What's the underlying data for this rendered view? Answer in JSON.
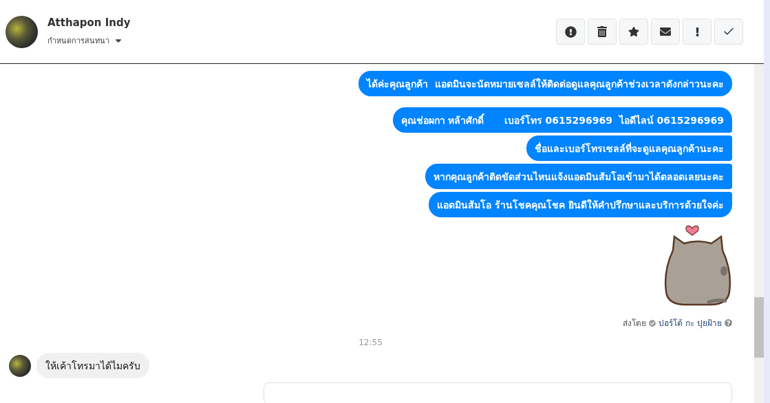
{
  "header": {
    "name": "Atthapon Indy",
    "subtitle": "กำหนดการสนทนา"
  },
  "thread": [
    {
      "kind": "group",
      "messages": [
        "ได้ค่ะคุณลูกค้า  แอดมินจะนัดหมายเซลล์ให้ติดต่อดูแลคุณลูกค้าช่วงเวลาดังกล่าวนะคะ"
      ]
    },
    {
      "kind": "group",
      "messages": [
        "คุณช่อผกา หล้าศักดิ์      เบอร์โทร 0615296969  ไอดีไลน์ 0615296969",
        "ชื่อและเบอร์โทรเซลล์ที่จะดูแลคุณลูกค้านะคะ",
        "หากคุณลูกค้าติดขัดส่วนไหนแจ้งแอดมินส้มโอเข้ามาได้ตลอดเลยนะคะ",
        "แอดมินส้มโอ ร้านโชคคุณโชค ยินดีให้คำปรึกษาและบริการด้วยใจค่ะ"
      ]
    },
    {
      "kind": "sticker"
    },
    {
      "kind": "sent_by",
      "prefix": "ส่งโดย",
      "author": "ปอร์โต้ กะ ปุยฝ้าย"
    },
    {
      "kind": "time",
      "text": "12:55"
    },
    {
      "kind": "incoming",
      "text": "ให้เค้าโทรมาได้ไมครับ"
    },
    {
      "kind": "partial"
    }
  ]
}
